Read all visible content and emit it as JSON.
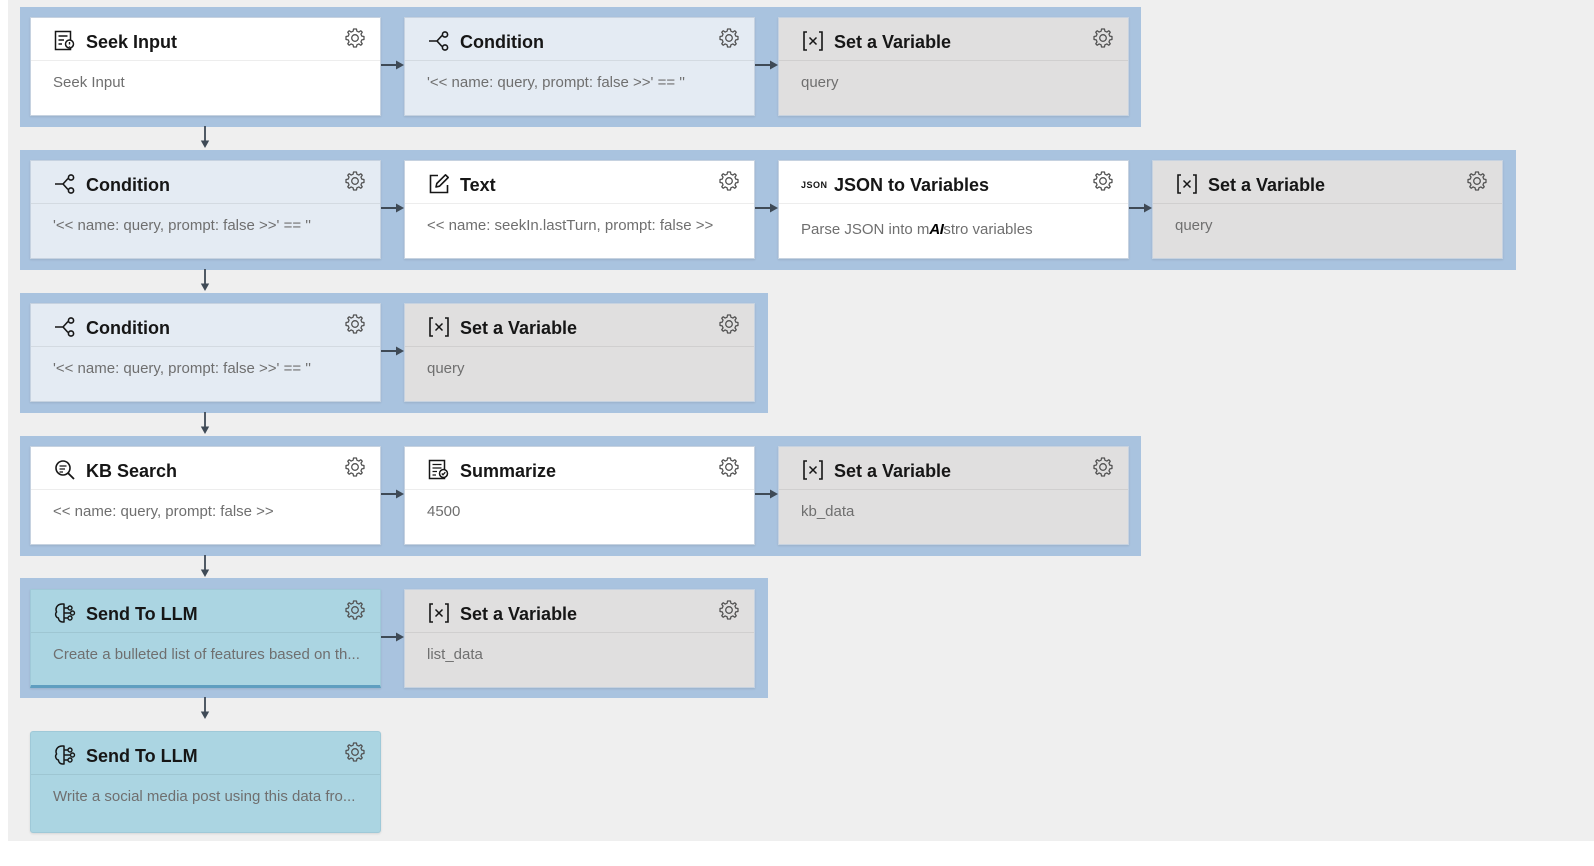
{
  "nodes": {
    "seek_input": {
      "title": "Seek Input",
      "desc": "Seek Input",
      "icon": "seek-input-icon"
    },
    "condition_1": {
      "title": "Condition",
      "desc": "'<< name: query, prompt: false >>' == ''",
      "icon": "condition-icon"
    },
    "set_var_1": {
      "title": "Set a Variable",
      "desc": "query",
      "icon": "variable-icon"
    },
    "condition_2": {
      "title": "Condition",
      "desc": "'<< name: query, prompt: false >>' == ''",
      "icon": "condition-icon"
    },
    "text_1": {
      "title": "Text",
      "desc": "<< name: seekIn.lastTurn, prompt: false >>",
      "icon": "edit-icon"
    },
    "json_vars": {
      "title": "JSON to Variables",
      "desc_prefix": "Parse JSON into m",
      "desc_brand": "AI",
      "desc_suffix": "stro variables",
      "icon": "json-icon",
      "icon_text": "JSON"
    },
    "set_var_2": {
      "title": "Set a Variable",
      "desc": "query",
      "icon": "variable-icon"
    },
    "condition_3": {
      "title": "Condition",
      "desc": "'<< name: query, prompt: false >>' == ''",
      "icon": "condition-icon"
    },
    "set_var_3": {
      "title": "Set a Variable",
      "desc": "query",
      "icon": "variable-icon"
    },
    "kb_search": {
      "title": "KB Search",
      "desc": "<< name: query, prompt: false >>",
      "icon": "kb-search-icon"
    },
    "summarize": {
      "title": "Summarize",
      "desc": "4500",
      "icon": "summarize-icon"
    },
    "set_var_4": {
      "title": "Set a Variable",
      "desc": "kb_data",
      "icon": "variable-icon"
    },
    "send_llm_1": {
      "title": "Send To LLM",
      "desc": "Create a bulleted list of features based on th...",
      "icon": "llm-icon"
    },
    "set_var_5": {
      "title": "Set a Variable",
      "desc": "list_data",
      "icon": "variable-icon"
    },
    "send_llm_2": {
      "title": "Send To LLM",
      "desc": "Write a social media post using this data fro...",
      "icon": "llm-icon"
    }
  },
  "colors": {
    "canvas": "#efefef",
    "band": "#a9c3df",
    "node_white": "#ffffff",
    "node_condition": "#e4ebf3",
    "node_variable": "#e0dfdf",
    "node_llm": "#abd5e2",
    "connector": "#3f4a56"
  }
}
